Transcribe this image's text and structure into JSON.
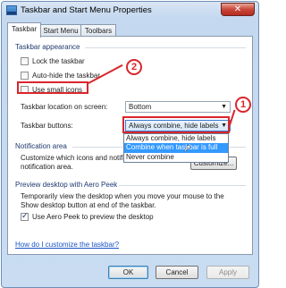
{
  "window": {
    "title": "Taskbar and Start Menu Properties",
    "close_label": "✕"
  },
  "tabs": [
    {
      "label": "Taskbar",
      "active": true
    },
    {
      "label": "Start Menu",
      "active": false
    },
    {
      "label": "Toolbars",
      "active": false
    }
  ],
  "appearance": {
    "group_title": "Taskbar appearance",
    "lock_label": "Lock the taskbar",
    "lock_checked": false,
    "autohide_label": "Auto-hide the taskbar",
    "autohide_checked": false,
    "small_icons_label": "Use small icons",
    "small_icons_checked": false,
    "location_label": "Taskbar location on screen:",
    "location_value": "Bottom",
    "buttons_label": "Taskbar buttons:",
    "buttons_value": "Always combine, hide labels",
    "buttons_options": [
      "Always combine, hide labels",
      "Combine when taskbar is full",
      "Never combine"
    ],
    "buttons_highlighted": "Combine when taskbar is full"
  },
  "notification": {
    "group_title": "Notification area",
    "description_line1": "Customize which icons and notifications appear in the",
    "description_line2": "notification area.",
    "customize_label": "Customize..."
  },
  "aero_peek": {
    "group_title": "Preview desktop with Aero Peek",
    "description_line1": "Temporarily view the desktop when you move your mouse to the",
    "description_line2": "Show desktop button at end of the taskbar.",
    "checkbox_label": "Use Aero Peek to preview the desktop",
    "checkbox_checked": true
  },
  "help_link": "How do I customize the taskbar?",
  "buttons": {
    "ok": "OK",
    "cancel": "Cancel",
    "apply": "Apply"
  },
  "callouts": {
    "one": "1",
    "two": "2"
  },
  "colors": {
    "callout": "#d9262c",
    "selection": "#3399ff",
    "link": "#1a54c7"
  }
}
